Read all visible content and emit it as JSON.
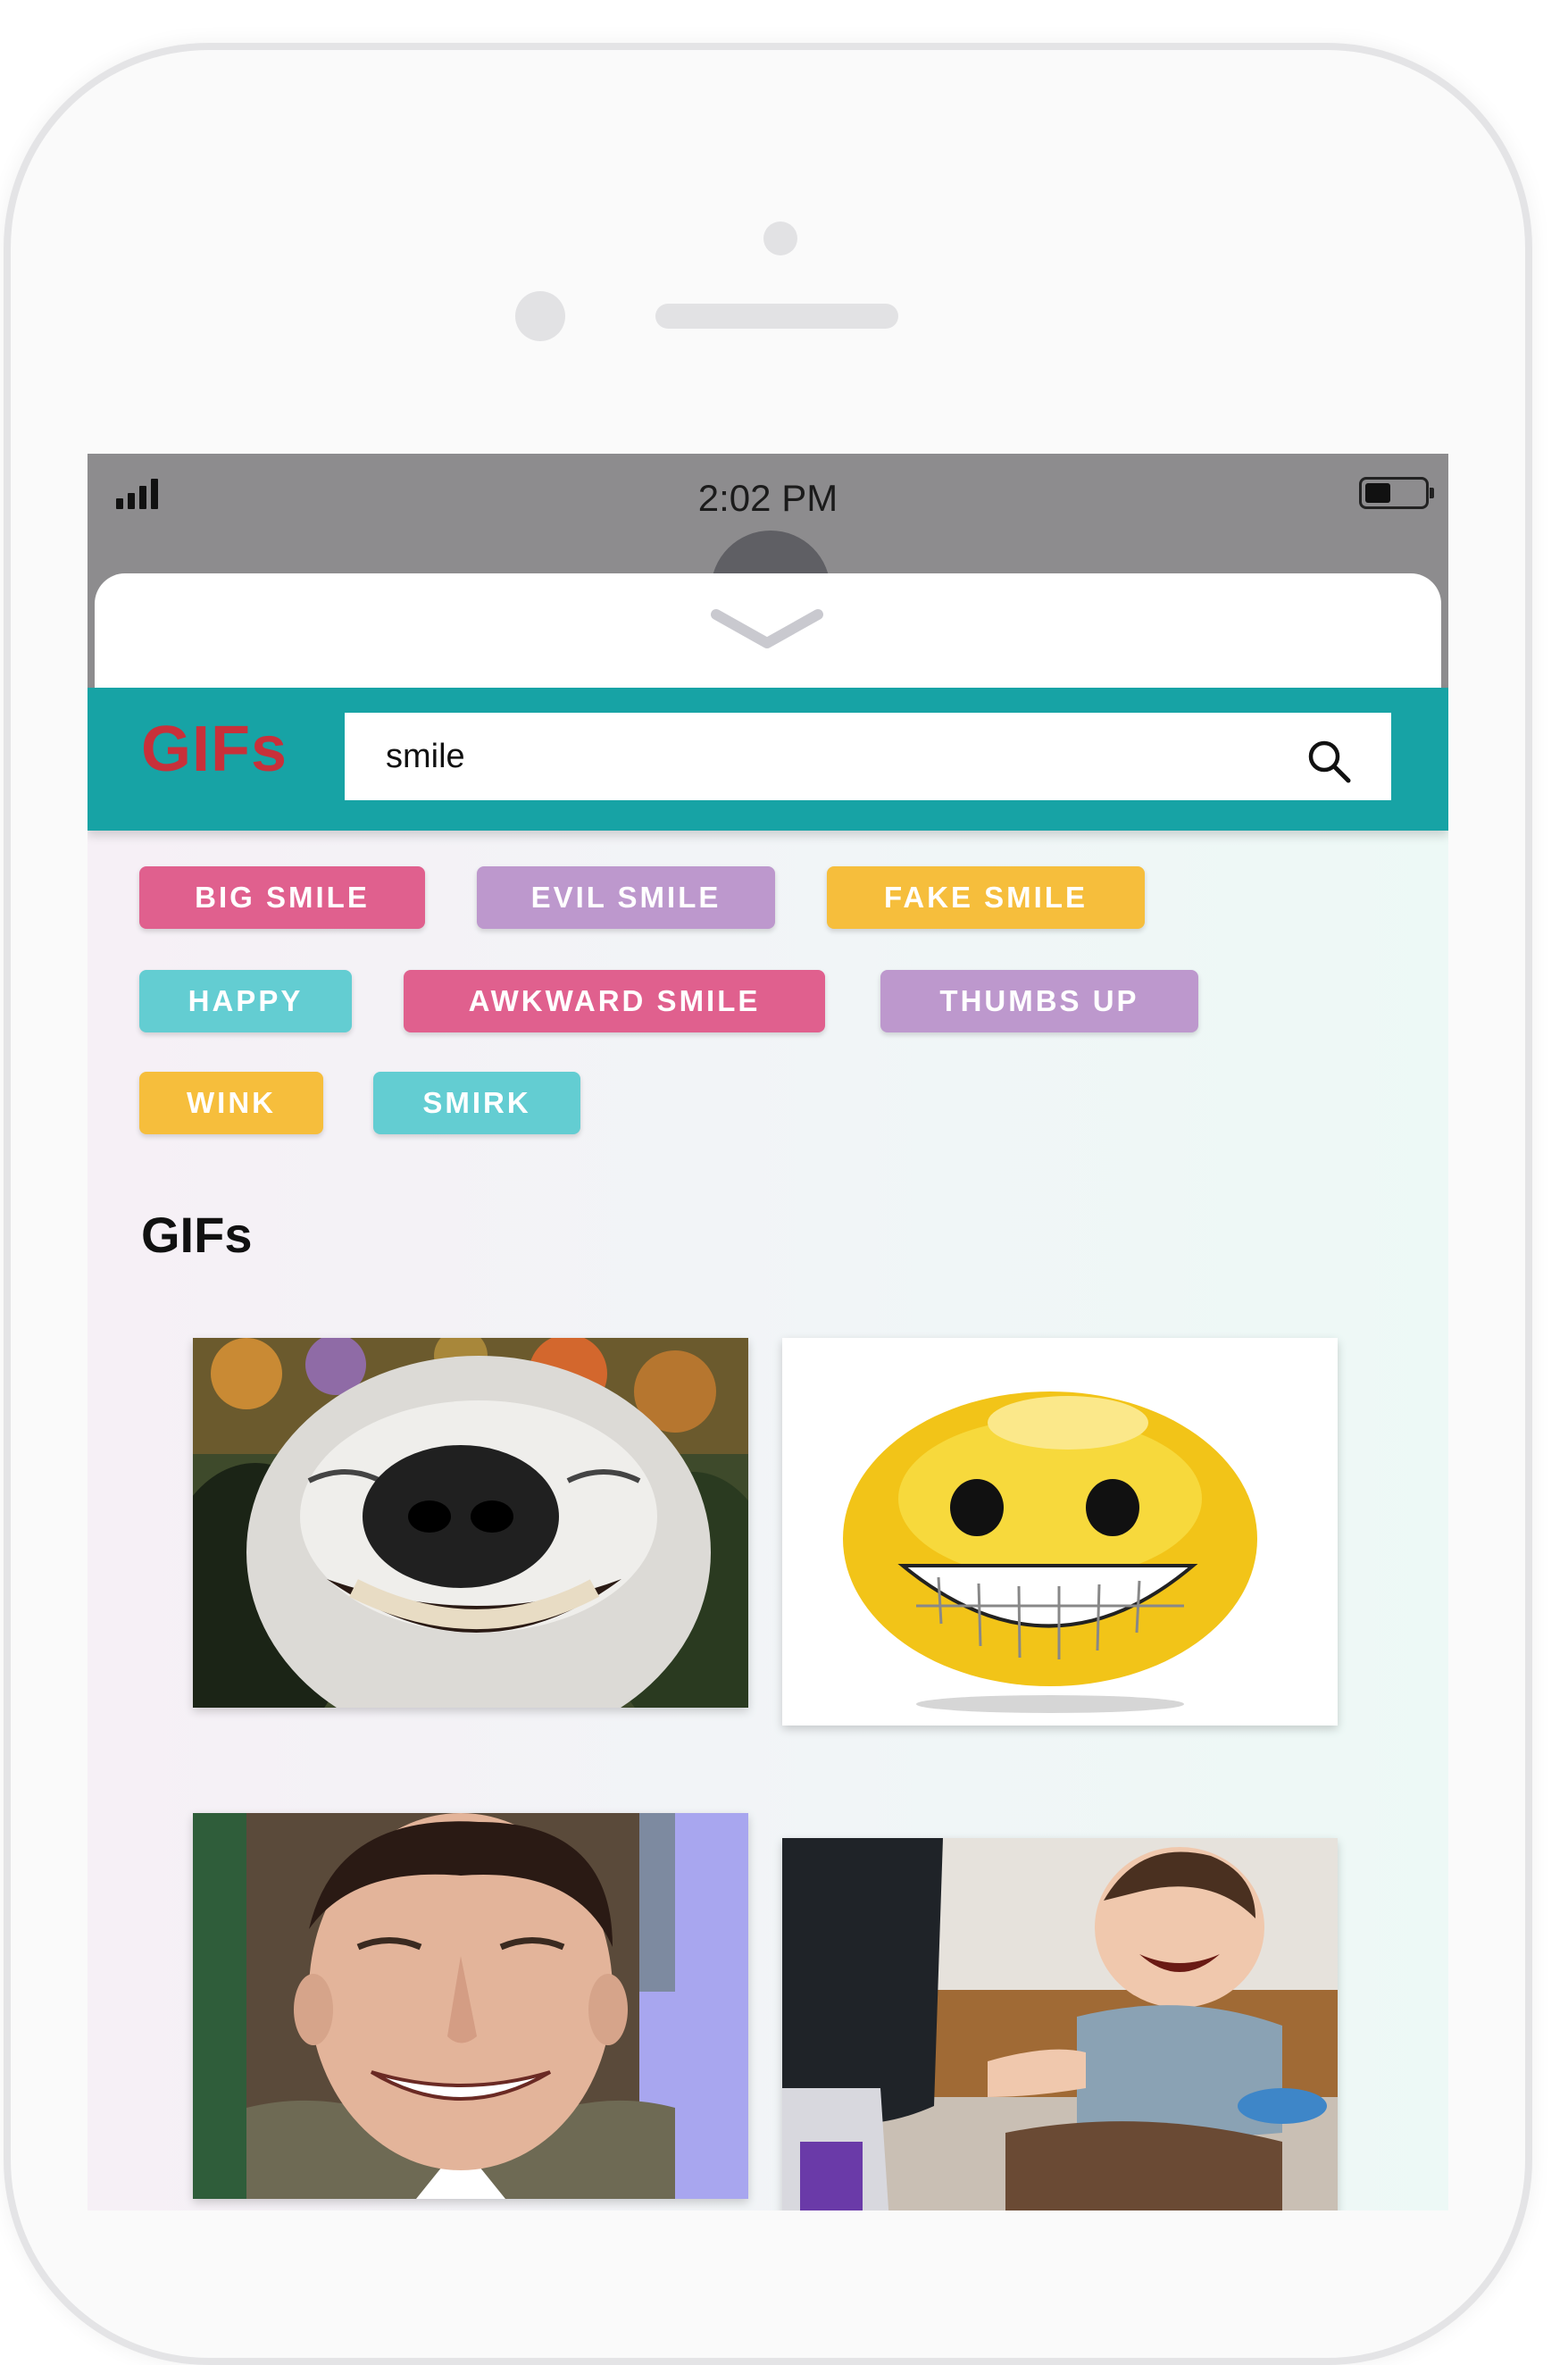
{
  "status_bar": {
    "time": "2:02 PM"
  },
  "header": {
    "brand": "GIFs"
  },
  "search": {
    "query": "smile"
  },
  "chips": [
    {
      "label": "BIG SMILE",
      "color": "#e0608e"
    },
    {
      "label": "EVIL SMILE",
      "color": "#bd98cd"
    },
    {
      "label": "FAKE SMILE",
      "color": "#f6be3c"
    },
    {
      "label": "HAPPY",
      "color": "#63cdd2"
    },
    {
      "label": "AWKWARD SMILE",
      "color": "#e0608e"
    },
    {
      "label": "THUMBS UP",
      "color": "#bd98cd"
    },
    {
      "label": "WINK",
      "color": "#f6be3c"
    },
    {
      "label": "SMIRK",
      "color": "#63cdd2"
    }
  ],
  "results": {
    "title": "GIFs",
    "items": [
      {
        "name": "smiling-dog-gif"
      },
      {
        "name": "grinning-emoji-gif"
      },
      {
        "name": "smiling-man-gif"
      },
      {
        "name": "laughing-toddler-gif"
      }
    ]
  },
  "colors": {
    "header_bg": "#17a3a5",
    "brand": "#c8303a",
    "status_bar": "#8d8c8e"
  }
}
